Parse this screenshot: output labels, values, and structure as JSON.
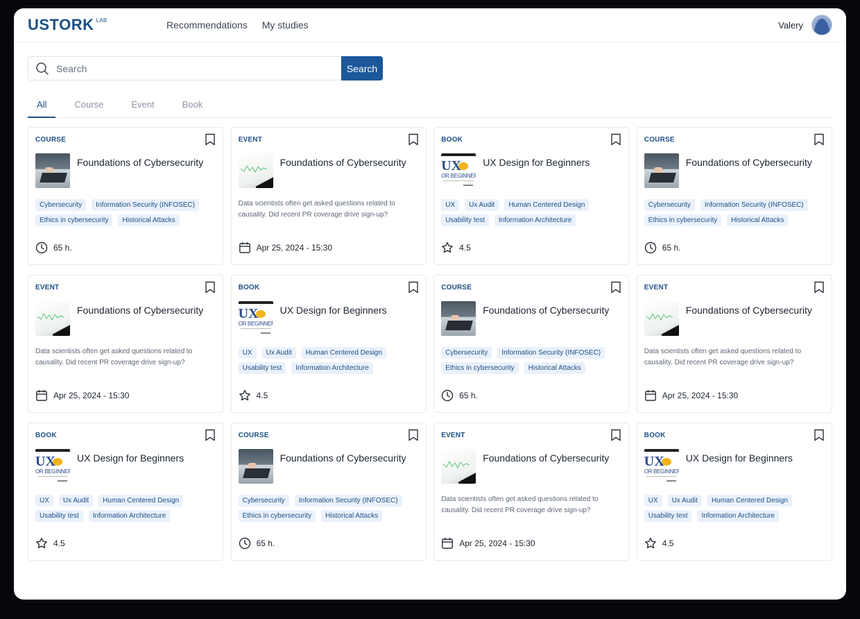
{
  "header": {
    "logo": "USTORK",
    "logo_sup": "LAB",
    "nav": [
      "Recommendations",
      "My studies"
    ],
    "user_name": "Valery"
  },
  "search": {
    "placeholder": "Search",
    "value": "",
    "button_label": "Search"
  },
  "tabs": [
    {
      "label": "All",
      "active": true
    },
    {
      "label": "Course",
      "active": false
    },
    {
      "label": "Event",
      "active": false
    },
    {
      "label": "Book",
      "active": false
    }
  ],
  "templates": {
    "course": {
      "type": "COURSE",
      "title": "Foundations of Cybersecurity",
      "tags": [
        "Cybersecurity",
        "Information Security (INFOSEC)",
        "Ethics in cybersecurity",
        "Historical Attacks"
      ],
      "meta_icon": "clock-icon",
      "meta": "65 h."
    },
    "event": {
      "type": "EVENT",
      "title": "Foundations of Cybersecurity",
      "description": "Data scientists often get asked questions related to causality. Did recent PR coverage drive sign-up?",
      "meta_icon": "calendar-icon",
      "meta": "Apr 25, 2024 - 15:30"
    },
    "book": {
      "type": "BOOK",
      "title": "UX Design for Beginners",
      "cover_text": "UX",
      "cover_subtitle": "OR BEGINNER",
      "tags": [
        "UX",
        "Ux Audit",
        "Human Centered Design",
        "Usability test",
        "Information Architecture"
      ],
      "meta_icon": "star-icon",
      "meta": "4.5"
    }
  },
  "cards": [
    "course",
    "event",
    "book",
    "course",
    "event",
    "book",
    "course",
    "event",
    "book",
    "course",
    "event",
    "book"
  ],
  "colors": {
    "brand": "#1b4f86",
    "button": "#1b5799",
    "tag_bg": "#eaf1fb",
    "backdrop": "#05070d"
  }
}
